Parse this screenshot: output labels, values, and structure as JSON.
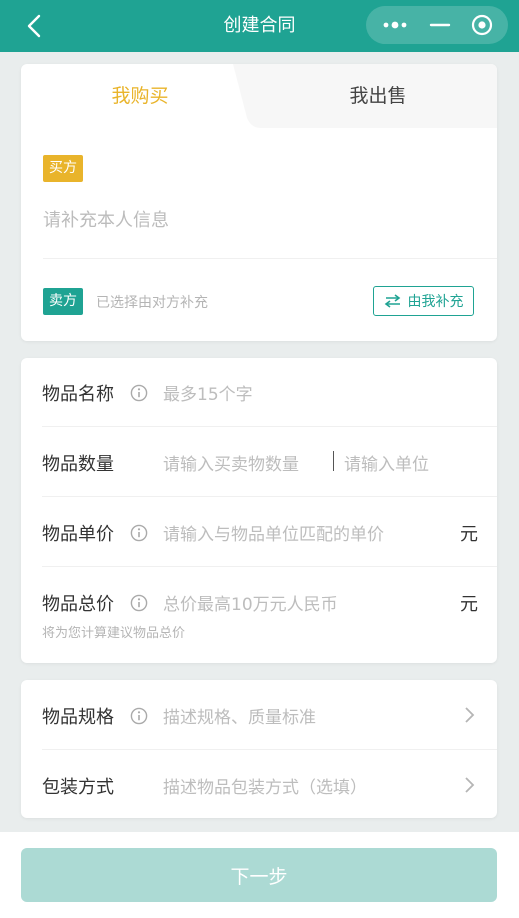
{
  "header": {
    "title": "创建合同",
    "back_icon": "chevron-left-icon",
    "menu_icon": "more-dots-icon",
    "minimize_icon": "minus-icon",
    "close_icon": "target-icon"
  },
  "tabs": [
    {
      "label": "我购买",
      "active": true,
      "color": "#e9b42b"
    },
    {
      "label": "我出售",
      "active": false
    }
  ],
  "buyer": {
    "badge": "买方",
    "placeholder": "请补充本人信息"
  },
  "seller": {
    "badge": "卖方",
    "note": "已选择由对方补充",
    "fill_button": "由我补充",
    "fill_icon": "swap-arrows-icon"
  },
  "fields": {
    "name": {
      "label": "物品名称",
      "placeholder": "最多15个字"
    },
    "quantity": {
      "label": "物品数量",
      "placeholder": "请输入买卖物数量",
      "unit_placeholder": "请输入单位"
    },
    "unit_price": {
      "label": "物品单价",
      "placeholder": "请输入与物品单位匹配的单价",
      "unit": "元"
    },
    "total_price": {
      "label": "物品总价",
      "placeholder": "总价最高10万元人民币",
      "unit": "元",
      "hint": "将为您计算建议物品总价"
    },
    "spec": {
      "label": "物品规格",
      "placeholder": "描述规格、质量标准"
    },
    "packaging": {
      "label": "包装方式",
      "placeholder": "描述物品包装方式（选填）"
    }
  },
  "footer": {
    "next_button": "下一步"
  },
  "colors": {
    "primary": "#1fa393",
    "accent": "#e9b42b",
    "button_disabled": "#acdad4"
  }
}
